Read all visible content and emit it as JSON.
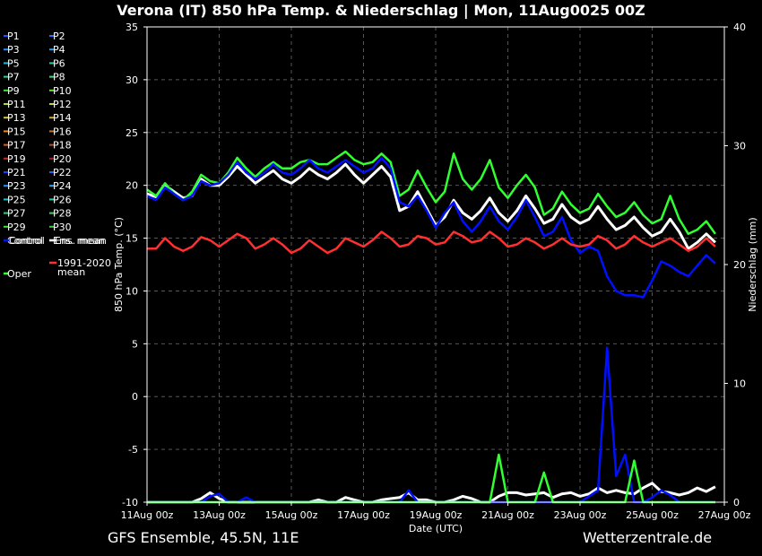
{
  "title": "Verona  (IT)  850 hPa Temp. & Niederschlag | Mon, 11Aug0025 00Z",
  "footer": {
    "left": "GFS Ensemble, 45.5N, 11E",
    "right": "Wetterzentrale.de"
  },
  "chart_data": {
    "type": "line",
    "title": "Verona  (IT)  850 hPa Temp. & Niederschlag | Mon, 11Aug0025 00Z",
    "xlabel": "Date (UTC)",
    "ylabel": "850 hPa Temp. (°C)",
    "y2label": "Niederschlag (mm)",
    "ylim": [
      -10,
      35
    ],
    "y2lim": [
      0,
      40
    ],
    "yticks": [
      "35",
      "30",
      "25",
      "20",
      "15",
      "10",
      "5",
      "0",
      "-5",
      "-10"
    ],
    "y2ticks": [
      "40",
      "30",
      "20",
      "10",
      "0"
    ],
    "xticks": [
      "11Aug 00z",
      "13Aug 00z",
      "15Aug 00z",
      "17Aug 00z",
      "19Aug 00z",
      "21Aug 00z",
      "23Aug 00z",
      "25Aug 00z",
      "27Aug 00z"
    ],
    "x_start": "11Aug 00z",
    "step_hours": 6,
    "grid": true,
    "legend_placement": "left",
    "legend": [
      {
        "label": "P1",
        "color": "#1f4fff"
      },
      {
        "label": "P2",
        "color": "#2d6bff"
      },
      {
        "label": "P3",
        "color": "#2a8cff"
      },
      {
        "label": "P4",
        "color": "#1fa0ff"
      },
      {
        "label": "P5",
        "color": "#1fb8d8"
      },
      {
        "label": "P6",
        "color": "#1fd0a8"
      },
      {
        "label": "P7",
        "color": "#1fd890"
      },
      {
        "label": "P8",
        "color": "#2ee070"
      },
      {
        "label": "P9",
        "color": "#3ee040"
      },
      {
        "label": "P10",
        "color": "#5fe030"
      },
      {
        "label": "P11",
        "color": "#a0e040"
      },
      {
        "label": "P12",
        "color": "#c8d040"
      },
      {
        "label": "P13",
        "color": "#e0c030"
      },
      {
        "label": "P14",
        "color": "#e0a020"
      },
      {
        "label": "P15",
        "color": "#e08a20"
      },
      {
        "label": "P16",
        "color": "#c87020"
      },
      {
        "label": "P17",
        "color": "#d86020"
      },
      {
        "label": "P18",
        "color": "#c84820"
      },
      {
        "label": "P19",
        "color": "#b83020"
      },
      {
        "label": "P20",
        "color": "#a02020"
      },
      {
        "label": "P21",
        "color": "#2040ff"
      },
      {
        "label": "P22",
        "color": "#2060ff"
      },
      {
        "label": "P23",
        "color": "#2a90ff"
      },
      {
        "label": "P24",
        "color": "#20a8ff"
      },
      {
        "label": "P25",
        "color": "#20c0c8"
      },
      {
        "label": "P26",
        "color": "#20d0a0"
      },
      {
        "label": "P27",
        "color": "#20d880"
      },
      {
        "label": "P28",
        "color": "#30d860"
      },
      {
        "label": "P29",
        "color": "#40e040"
      },
      {
        "label": "P30",
        "color": "#30d030"
      },
      {
        "label": "Control",
        "color": "#0010ff"
      },
      {
        "label": "Ens. mean",
        "color": "#ffffff"
      },
      {
        "label": "1991-2020\nmean",
        "color": "#ff3030"
      },
      {
        "label": "Oper",
        "color": "#30ff30"
      }
    ],
    "series": [
      {
        "name": "Ens. mean",
        "color": "#ffffff",
        "axis": "left",
        "values": [
          19.2,
          18.9,
          20.0,
          19.4,
          18.8,
          19.0,
          20.6,
          20.0,
          20.0,
          20.8,
          21.8,
          21.0,
          20.2,
          20.8,
          21.4,
          20.6,
          20.2,
          20.8,
          21.6,
          21.0,
          20.6,
          21.2,
          22.0,
          21.0,
          20.2,
          21.0,
          21.8,
          20.8,
          17.6,
          18.0,
          19.4,
          17.8,
          16.2,
          17.0,
          18.6,
          17.4,
          16.8,
          17.6,
          18.8,
          17.4,
          16.6,
          17.6,
          19.0,
          17.8,
          16.4,
          16.8,
          18.2,
          17.0,
          16.4,
          16.8,
          18.0,
          16.8,
          15.8,
          16.2,
          17.0,
          16.0,
          15.2,
          15.6,
          16.8,
          15.6,
          14.0,
          14.6,
          15.4,
          14.6
        ]
      },
      {
        "name": "Oper",
        "color": "#30ff30",
        "axis": "left",
        "values": [
          19.6,
          19.0,
          20.2,
          19.2,
          18.6,
          19.4,
          21.0,
          20.4,
          20.2,
          21.2,
          22.6,
          21.6,
          20.8,
          21.6,
          22.2,
          21.6,
          21.6,
          22.2,
          22.4,
          22.0,
          22.0,
          22.6,
          23.2,
          22.4,
          22.0,
          22.2,
          23.0,
          22.2,
          19.0,
          19.6,
          21.4,
          19.8,
          18.4,
          19.4,
          23.0,
          20.6,
          19.6,
          20.6,
          22.4,
          19.8,
          18.8,
          20.0,
          21.0,
          19.8,
          17.2,
          17.8,
          19.4,
          18.2,
          17.4,
          17.8,
          19.2,
          18.0,
          17.0,
          17.4,
          18.4,
          17.2,
          16.4,
          16.8,
          19.0,
          16.8,
          15.4,
          15.8,
          16.6,
          15.4
        ]
      },
      {
        "name": "Control",
        "color": "#0010ff",
        "axis": "left",
        "values": [
          19.0,
          18.6,
          19.8,
          19.2,
          18.6,
          19.0,
          20.4,
          20.0,
          20.2,
          21.0,
          22.2,
          21.2,
          20.6,
          21.2,
          22.0,
          21.2,
          21.0,
          21.6,
          22.4,
          21.6,
          21.2,
          21.8,
          22.4,
          21.8,
          21.2,
          21.6,
          22.6,
          21.6,
          18.4,
          18.0,
          19.0,
          17.6,
          16.0,
          17.4,
          18.4,
          16.6,
          15.6,
          16.6,
          18.0,
          16.6,
          15.8,
          17.0,
          18.6,
          17.0,
          15.2,
          15.6,
          17.0,
          14.8,
          13.6,
          14.2,
          13.8,
          11.4,
          10.0,
          9.6,
          9.6,
          9.4,
          11.0,
          12.8,
          12.4,
          11.8,
          11.4,
          12.4,
          13.4,
          12.6
        ]
      },
      {
        "name": "1991-2020 mean",
        "color": "#ff3030",
        "axis": "left",
        "values": [
          14.0,
          14.0,
          15.0,
          14.2,
          13.8,
          14.2,
          15.1,
          14.8,
          14.2,
          14.8,
          15.4,
          15.0,
          14.0,
          14.4,
          15.0,
          14.4,
          13.6,
          14.0,
          14.8,
          14.2,
          13.6,
          14.0,
          15.0,
          14.6,
          14.2,
          14.8,
          15.6,
          15.0,
          14.2,
          14.4,
          15.2,
          15.0,
          14.4,
          14.6,
          15.6,
          15.2,
          14.6,
          14.8,
          15.6,
          15.0,
          14.2,
          14.4,
          15.0,
          14.6,
          14.0,
          14.4,
          15.0,
          14.4,
          14.2,
          14.4,
          15.2,
          14.8,
          14.0,
          14.4,
          15.2,
          14.6,
          14.2,
          14.6,
          15.0,
          14.4,
          13.8,
          14.2,
          15.0,
          14.2
        ]
      },
      {
        "name": "Ens. mean",
        "color": "#ffffff",
        "axis": "right",
        "values": [
          0,
          0,
          0,
          0,
          0,
          0,
          0.3,
          0.8,
          0.3,
          0,
          0,
          0,
          0,
          0,
          0,
          0,
          0,
          0,
          0,
          0.2,
          0,
          0,
          0.4,
          0.2,
          0,
          0,
          0.2,
          0.3,
          0.4,
          0.8,
          0.2,
          0.2,
          0,
          0,
          0.2,
          0.5,
          0.3,
          0,
          0,
          0.5,
          0.8,
          0.8,
          0.6,
          0.7,
          0.8,
          0.4,
          0.7,
          0.8,
          0.5,
          0.7,
          1.2,
          0.8,
          1.0,
          0.8,
          0.7,
          1.2,
          1.6,
          0.9,
          0.8,
          0.6,
          0.8,
          1.2,
          0.9,
          1.3
        ]
      },
      {
        "name": "Control",
        "color": "#0010ff",
        "axis": "right",
        "values": [
          0,
          0,
          0,
          0,
          0,
          0,
          0,
          0.5,
          0.7,
          0,
          0,
          0.4,
          0,
          0,
          0,
          0,
          0,
          0,
          0,
          0,
          0,
          0,
          0,
          0,
          0,
          0,
          0,
          0,
          0,
          1.0,
          0,
          0,
          0,
          0,
          0,
          0,
          0,
          0,
          0,
          0,
          0,
          0,
          0,
          0,
          0,
          0,
          0,
          0,
          0,
          0.5,
          1.0,
          13.0,
          2.2,
          4.0,
          0,
          0,
          0.4,
          1.0,
          0.6,
          0,
          0,
          0,
          0,
          0
        ]
      },
      {
        "name": "Oper",
        "color": "#30ff30",
        "axis": "right",
        "values": [
          0,
          0,
          0,
          0,
          0,
          0,
          0,
          0,
          0,
          0,
          0,
          0,
          0,
          0,
          0,
          0,
          0,
          0,
          0,
          0,
          0,
          0,
          0,
          0,
          0,
          0,
          0,
          0,
          0,
          0,
          0,
          0,
          0,
          0,
          0,
          0,
          0,
          0,
          0,
          4.0,
          0,
          0,
          0,
          0,
          2.5,
          0,
          0,
          0,
          0,
          0,
          0,
          0,
          0,
          0,
          3.5,
          0,
          0,
          0,
          0,
          0,
          0,
          0,
          0,
          0
        ]
      }
    ]
  }
}
